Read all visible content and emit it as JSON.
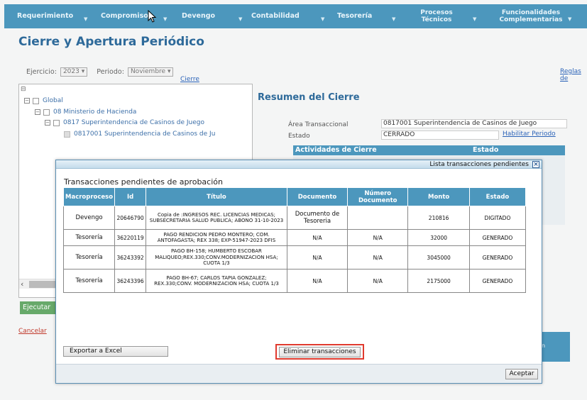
{
  "nav": {
    "items": [
      {
        "label": "Requerimiento"
      },
      {
        "label": "Compromiso"
      },
      {
        "label": "Devengo"
      },
      {
        "label": "Contabilidad"
      },
      {
        "label": "Tesorería"
      },
      {
        "label": "Procesos Técnicos"
      },
      {
        "label": "Funcionalidades Complementarias"
      }
    ]
  },
  "page": {
    "title": "Cierre y Apertura Periódico",
    "ejercicio_label": "Ejercicio:",
    "ejercicio_value": "2023",
    "periodo_label": "Periodo:",
    "periodo_value": "Noviembre",
    "cierre_link": "Cierre",
    "reglas_link": "Reglas de"
  },
  "tree": {
    "root_toggle": "⊟",
    "items": [
      {
        "label": "Global"
      },
      {
        "label": "08 Ministerio de Hacienda"
      },
      {
        "label": "0817 Superintendencia de Casinos de Juego"
      },
      {
        "label": "0817001 Superintendencia de Casinos de Ju"
      }
    ]
  },
  "actions": {
    "ejecutar": "Ejecutar",
    "cancelar": "Cancelar"
  },
  "resumen": {
    "title": "Resumen del Cierre",
    "area_label": "Área Transaccional",
    "area_value": "0817001 Superintendencia de Casinos de Juego",
    "estado_label": "Estado",
    "estado_value": "CERRADO",
    "habilitar_link": "Habilitar Periodo",
    "actividades_header": "Actividades de Cierre",
    "estado_header": "Estado",
    "right_box_text": "n"
  },
  "modal": {
    "window_title": "Lista transacciones pendientes",
    "heading": "Transacciones pendientes de aprobación",
    "columns": [
      "Macroproceso",
      "Id",
      "Título",
      "Documento",
      "Número Documento",
      "Monto",
      "Estado"
    ],
    "rows": [
      {
        "macro": "Devengo",
        "id": "20646790",
        "titulo": "Copia de :INGRESOS REC. LICENCIAS MEDICAS; SUBSECRETARIA SALUD PUBLICA; ABONO 31-10-2023",
        "documento": "Documento de Tesoreria",
        "numero": "",
        "monto": "210816",
        "estado": "DIGITADO"
      },
      {
        "macro": "Tesorería",
        "id": "36220119",
        "titulo": "PAGO RENDICION PEDRO MONTERO; COM. ANTOFAGASTA; REX 338; EXP-51947-2023 DFIS",
        "documento": "N/A",
        "numero": "N/A",
        "monto": "32000",
        "estado": "GENERADO"
      },
      {
        "macro": "Tesorería",
        "id": "36243392",
        "titulo": "PAGO BH-158; HUMBERTO ESCOBAR MALIQUEO;REX.330;CONV.MODERNIZACION HSA; CUOTA 1/3",
        "documento": "N/A",
        "numero": "N/A",
        "monto": "3045000",
        "estado": "GENERADO"
      },
      {
        "macro": "Tesorería",
        "id": "36243396",
        "titulo": "PAGO BH-67; CARLOS TAPIA GONZALEZ; REX.330;CONV. MODERNIZACION HSA; CUOTA 1/3",
        "documento": "N/A",
        "numero": "N/A",
        "monto": "2175000",
        "estado": "GENERADO"
      }
    ],
    "export_button": "Exportar a Excel",
    "delete_button": "Eliminar transacciones",
    "accept_button": "Aceptar",
    "close_symbol": "×"
  },
  "colors": {
    "nav_bg": "#4c97bd",
    "title_blue": "#2e6a9a",
    "highlight_red": "#e03a2e",
    "ejecutar_green": "#67a96a"
  }
}
